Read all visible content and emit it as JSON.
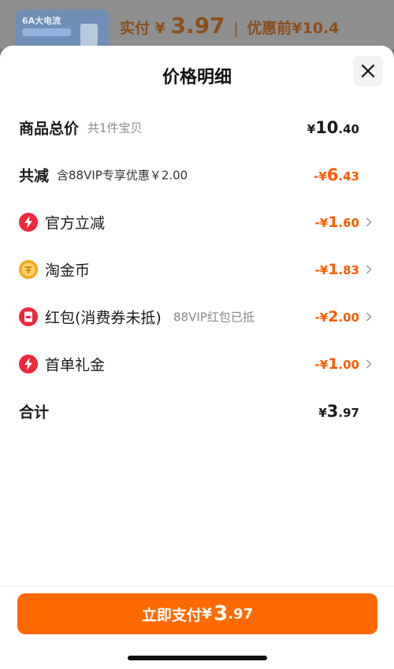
{
  "background": {
    "thumb_title": "6A大电流",
    "actual_pay_label": "实付",
    "actual_pay_currency": "¥",
    "actual_pay_amount": "3.97",
    "separator": "|",
    "before_discount": "优惠前¥10.4"
  },
  "sheet": {
    "title": "价格明细",
    "close_icon": "close-icon"
  },
  "rows": {
    "total": {
      "label": "商品总价",
      "note": "共1件宝贝",
      "currency": "¥",
      "int": "10",
      "dec": ".40"
    },
    "discount": {
      "label": "共减",
      "note": "含88VIP专享优惠￥2.00",
      "prefix": "-¥",
      "int": "6",
      "dec": ".43"
    },
    "official": {
      "icon": "lightning-icon",
      "label": "官方立减",
      "prefix": "-¥",
      "int": "1",
      "dec": ".60"
    },
    "coins": {
      "icon": "coin-icon",
      "label": "淘金币",
      "prefix": "-¥",
      "int": "1",
      "dec": ".83"
    },
    "redpacket": {
      "icon": "red-envelope-icon",
      "label": "红包(消费券未抵)",
      "note": "88VIP红包已抵",
      "prefix": "-¥",
      "int": "2",
      "dec": ".00"
    },
    "firstorder": {
      "icon": "lightning-icon",
      "label": "首单礼金",
      "prefix": "-¥",
      "int": "1",
      "dec": ".00"
    },
    "sum": {
      "label": "合计",
      "currency": "¥",
      "int": "3",
      "dec": ".97"
    }
  },
  "footer": {
    "pay_label": "立即支付",
    "pay_currency": "¥",
    "pay_int": "3",
    "pay_dec": ".97"
  },
  "colors": {
    "accent": "#ff6a00",
    "discount_text": "#ff5a00",
    "icon_red": "#f0263c",
    "icon_gold": "#f5a623"
  }
}
